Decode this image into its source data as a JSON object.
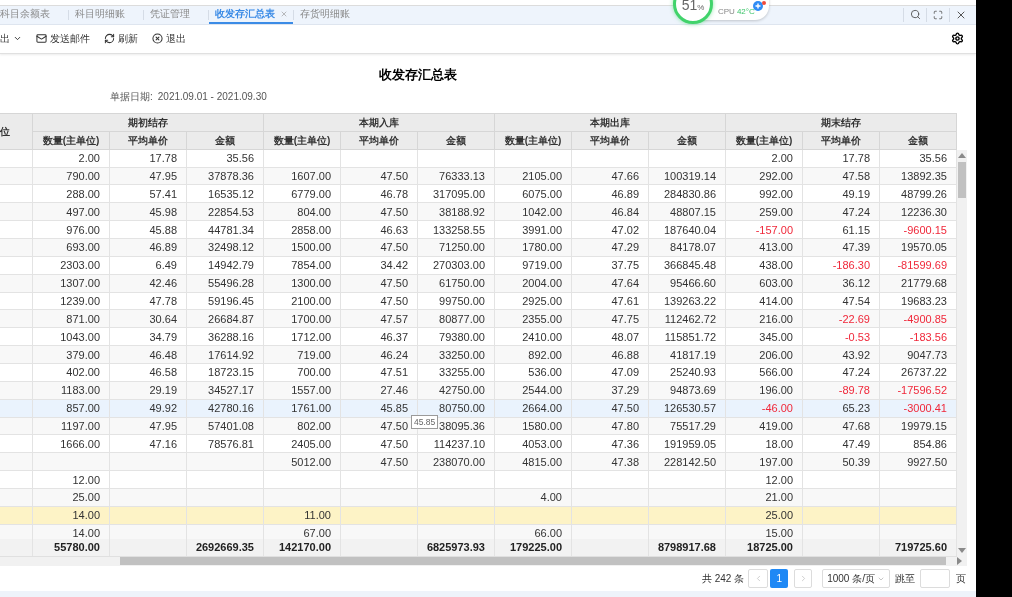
{
  "monitor_widget": {
    "value": "51",
    "unit": "%",
    "label": "CPU",
    "temperature": "42°C"
  },
  "tabs": [
    {
      "label": "科目余额表",
      "selected": false,
      "closable": false
    },
    {
      "label": "科目明细账",
      "selected": false,
      "closable": false
    },
    {
      "label": "凭证管理",
      "selected": false,
      "closable": false
    },
    {
      "label": "收发存汇总表",
      "selected": true,
      "closable": true
    },
    {
      "label": "存货明细账",
      "selected": false,
      "closable": false
    }
  ],
  "toolbar": [
    {
      "kind": "export",
      "label": "出"
    },
    {
      "kind": "mail",
      "label": "发送邮件"
    },
    {
      "kind": "refresh",
      "label": "刷新"
    },
    {
      "kind": "exit",
      "label": "退出"
    }
  ],
  "report": {
    "title": "收发存汇总表",
    "date_label": "单据日期:",
    "date_range": "2021.09.01 - 2021.09.30"
  },
  "table": {
    "column_1": "位",
    "groups": [
      {
        "label": "期初结存",
        "columns": [
          "数量(主单位)",
          "平均单价",
          "金额"
        ]
      },
      {
        "label": "本期入库",
        "columns": [
          "数量(主单位)",
          "平均单价",
          "金额"
        ]
      },
      {
        "label": "本期出库",
        "columns": [
          "数量(主单位)",
          "平均单价",
          "金额"
        ]
      },
      {
        "label": "期末结存",
        "columns": [
          "数量(主单位)",
          "平均单价",
          "金额"
        ]
      }
    ],
    "rows": [
      {
        "hovered": false,
        "selected": false,
        "cells": [
          "2.00",
          "17.78",
          "35.56",
          null,
          null,
          null,
          null,
          null,
          null,
          "2.00",
          "17.78",
          "35.56"
        ]
      },
      {
        "hovered": false,
        "selected": false,
        "cells": [
          "790.00",
          "47.95",
          "37878.36",
          "1607.00",
          "47.50",
          "76333.13",
          "2105.00",
          "47.66",
          "100319.14",
          "292.00",
          "47.58",
          "13892.35"
        ]
      },
      {
        "hovered": false,
        "selected": false,
        "cells": [
          "288.00",
          "57.41",
          "16535.12",
          "6779.00",
          "46.78",
          "317095.00",
          "6075.00",
          "46.89",
          "284830.86",
          "992.00",
          "49.19",
          "48799.26"
        ]
      },
      {
        "hovered": false,
        "selected": false,
        "cells": [
          "497.00",
          "45.98",
          "22854.53",
          "804.00",
          "47.50",
          "38188.92",
          "1042.00",
          "46.84",
          "48807.15",
          "259.00",
          "47.24",
          "12236.30"
        ]
      },
      {
        "hovered": false,
        "selected": false,
        "cells": [
          "976.00",
          "45.88",
          "44781.34",
          "2858.00",
          "46.63",
          "133258.55",
          "3991.00",
          "47.02",
          "187640.04",
          {
            "text": "-157.00",
            "negative": true
          },
          "61.15",
          {
            "text": "-9600.15",
            "negative": true
          }
        ]
      },
      {
        "hovered": false,
        "selected": false,
        "cells": [
          "693.00",
          "46.89",
          "32498.12",
          "1500.00",
          "47.50",
          "71250.00",
          "1780.00",
          "47.29",
          "84178.07",
          "413.00",
          "47.39",
          "19570.05"
        ]
      },
      {
        "hovered": false,
        "selected": false,
        "cells": [
          "2303.00",
          "6.49",
          "14942.79",
          "7854.00",
          "34.42",
          "270303.00",
          "9719.00",
          "37.75",
          "366845.48",
          "438.00",
          {
            "text": "-186.30",
            "negative": true
          },
          {
            "text": "-81599.69",
            "negative": true
          }
        ]
      },
      {
        "hovered": false,
        "selected": false,
        "cells": [
          "1307.00",
          "42.46",
          "55496.28",
          "1300.00",
          "47.50",
          "61750.00",
          "2004.00",
          "47.64",
          "95466.60",
          "603.00",
          "36.12",
          "21779.68"
        ]
      },
      {
        "hovered": false,
        "selected": false,
        "cells": [
          "1239.00",
          "47.78",
          "59196.45",
          "2100.00",
          "47.50",
          "99750.00",
          "2925.00",
          "47.61",
          "139263.22",
          "414.00",
          "47.54",
          "19683.23"
        ]
      },
      {
        "hovered": false,
        "selected": false,
        "cells": [
          "871.00",
          "30.64",
          "26684.87",
          "1700.00",
          "47.57",
          "80877.00",
          "2355.00",
          "47.75",
          "112462.72",
          "216.00",
          {
            "text": "-22.69",
            "negative": true
          },
          {
            "text": "-4900.85",
            "negative": true
          }
        ]
      },
      {
        "hovered": false,
        "selected": false,
        "cells": [
          "1043.00",
          "34.79",
          "36288.16",
          "1712.00",
          "46.37",
          "79380.00",
          "2410.00",
          "48.07",
          "115851.72",
          "345.00",
          {
            "text": "-0.53",
            "negative": true
          },
          {
            "text": "-183.56",
            "negative": true
          }
        ]
      },
      {
        "hovered": false,
        "selected": false,
        "cells": [
          "379.00",
          "46.48",
          "17614.92",
          "719.00",
          "46.24",
          "33250.00",
          "892.00",
          "46.88",
          "41817.19",
          "206.00",
          "43.92",
          "9047.73"
        ]
      },
      {
        "hovered": false,
        "selected": false,
        "cells": [
          "402.00",
          "46.58",
          "18723.15",
          "700.00",
          "47.51",
          "33255.00",
          "536.00",
          "47.09",
          "25240.93",
          "566.00",
          "47.24",
          "26737.22"
        ]
      },
      {
        "hovered": false,
        "selected": false,
        "cells": [
          "1183.00",
          "29.19",
          "34527.17",
          "1557.00",
          "27.46",
          "42750.00",
          "2544.00",
          "37.29",
          "94873.69",
          "196.00",
          {
            "text": "-89.78",
            "negative": true
          },
          {
            "text": "-17596.52",
            "negative": true
          }
        ]
      },
      {
        "hovered": true,
        "selected": false,
        "cells": [
          "857.00",
          "49.92",
          "42780.16",
          "1761.00",
          "45.85",
          "80750.00",
          "2664.00",
          "47.50",
          "126530.57",
          {
            "text": "-46.00",
            "negative": true
          },
          "65.23",
          {
            "text": "-3000.41",
            "negative": true
          }
        ]
      },
      {
        "hovered": false,
        "selected": false,
        "cells": [
          "1197.00",
          "47.95",
          "57401.08",
          "802.00",
          "47.50",
          "38095.36",
          "1580.00",
          "47.80",
          "75517.29",
          "419.00",
          "47.68",
          "19979.15"
        ]
      },
      {
        "hovered": false,
        "selected": false,
        "cells": [
          "1666.00",
          "47.16",
          "78576.81",
          "2405.00",
          "47.50",
          "114237.10",
          "4053.00",
          "47.36",
          "191959.05",
          "18.00",
          "47.49",
          "854.86"
        ]
      },
      {
        "hovered": false,
        "selected": false,
        "cells": [
          null,
          null,
          null,
          "5012.00",
          "47.50",
          "238070.00",
          "4815.00",
          "47.38",
          "228142.50",
          "197.00",
          "50.39",
          "9927.50"
        ]
      },
      {
        "hovered": false,
        "selected": false,
        "cells": [
          "12.00",
          null,
          null,
          null,
          null,
          null,
          null,
          null,
          null,
          "12.00",
          null,
          null
        ]
      },
      {
        "hovered": false,
        "selected": false,
        "cells": [
          "25.00",
          null,
          null,
          null,
          null,
          null,
          "4.00",
          null,
          null,
          "21.00",
          null,
          null
        ]
      },
      {
        "hovered": false,
        "selected": true,
        "cells": [
          "14.00",
          null,
          null,
          "11.00",
          null,
          null,
          null,
          null,
          null,
          "25.00",
          null,
          null
        ]
      },
      {
        "hovered": false,
        "selected": false,
        "cells": [
          "14.00",
          null,
          null,
          "67.00",
          null,
          null,
          "66.00",
          null,
          null,
          "15.00",
          null,
          null
        ]
      }
    ],
    "totals": [
      {
        "quantity": "55780.00",
        "amount": "2692669.35"
      },
      {
        "quantity": "142170.00",
        "amount": "6825973.93"
      },
      {
        "quantity": "179225.00",
        "amount": "8798917.68"
      },
      {
        "quantity": "18725.00",
        "amount": "719725.60"
      }
    ],
    "tooltip": "45.85"
  },
  "pagination": {
    "total": "共 242 条",
    "pages": [
      {
        "label": "1",
        "selected": true
      }
    ],
    "page_size": "1000 条/页",
    "jump_label": "跳至",
    "page_suffix": "页"
  }
}
